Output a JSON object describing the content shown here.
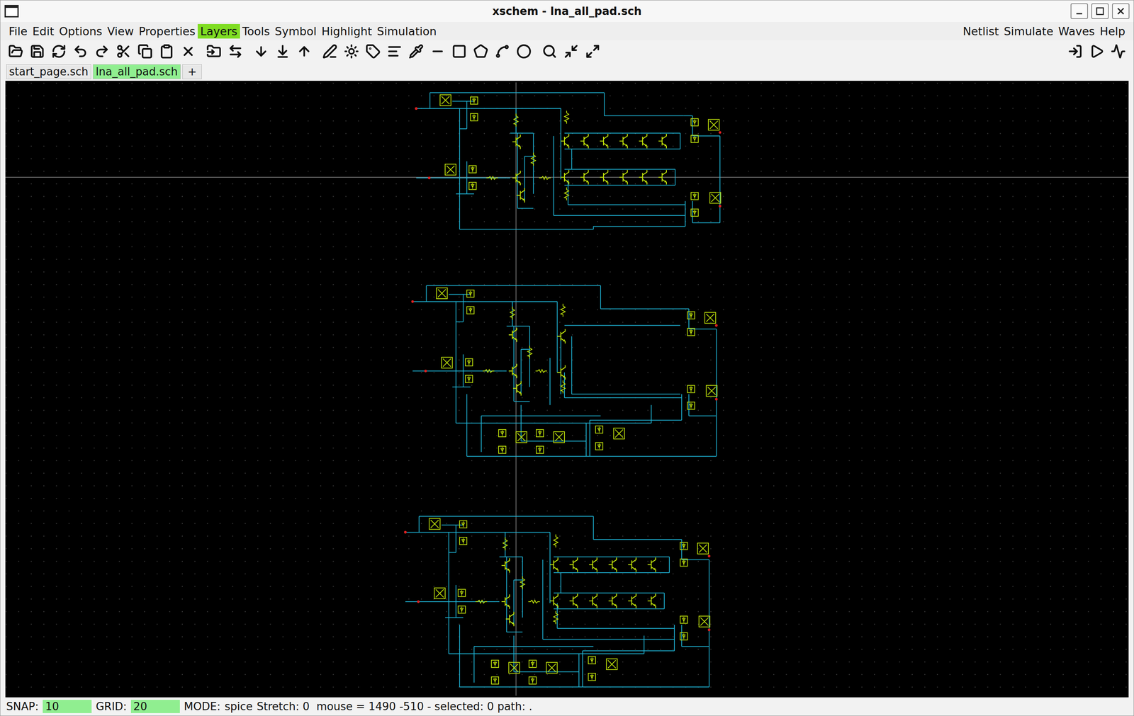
{
  "window": {
    "title": "xschem - lna_all_pad.sch"
  },
  "menu": {
    "left": [
      {
        "label": "File",
        "highlighted": false
      },
      {
        "label": "Edit",
        "highlighted": false
      },
      {
        "label": "Options",
        "highlighted": false
      },
      {
        "label": "View",
        "highlighted": false
      },
      {
        "label": "Properties",
        "highlighted": false
      },
      {
        "label": "Layers",
        "highlighted": true
      },
      {
        "label": "Tools",
        "highlighted": false
      },
      {
        "label": "Symbol",
        "highlighted": false
      },
      {
        "label": "Highlight",
        "highlighted": false
      },
      {
        "label": "Simulation",
        "highlighted": false
      }
    ],
    "right": [
      "Netlist",
      "Simulate",
      "Waves",
      "Help"
    ]
  },
  "tabs": [
    {
      "label": "start_page.sch",
      "selected": false
    },
    {
      "label": "lna_all_pad.sch",
      "selected": true
    },
    {
      "label": "+",
      "selected": false
    }
  ],
  "status_bar": {
    "snap_label": "SNAP:",
    "snap": "10",
    "grid_label": "GRID:",
    "grid": "20",
    "mode_label": "MODE:",
    "mode": "spice",
    "info": "Stretch: 0  mouse = 1490 -510 - selected: 0 path: ."
  }
}
